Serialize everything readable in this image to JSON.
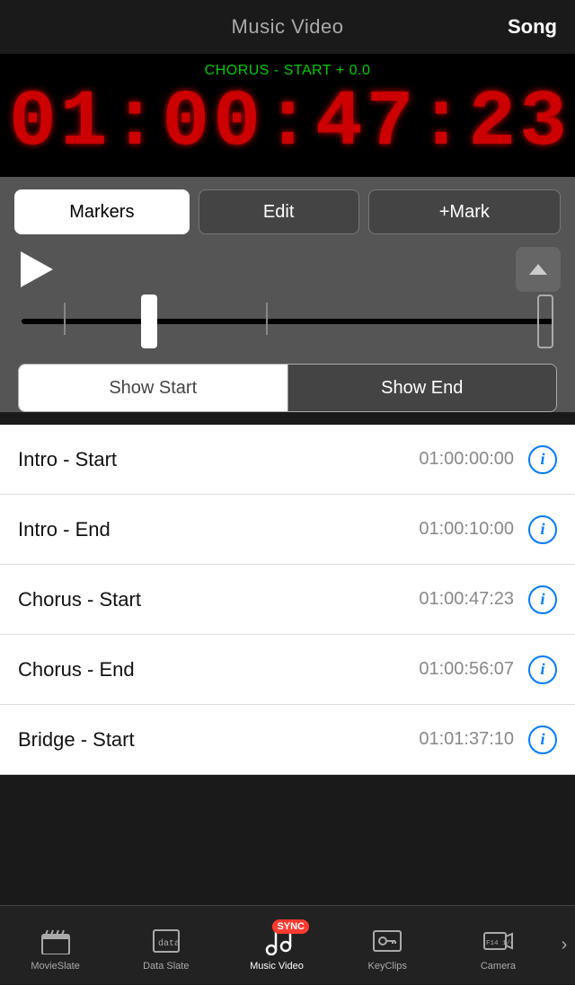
{
  "header": {
    "title": "Music Video",
    "song_label": "Song"
  },
  "timecode": {
    "label": "CHORUS - START + 0.0",
    "display": "01:00:47:23"
  },
  "toolbar": {
    "markers_label": "Markers",
    "edit_label": "Edit",
    "mark_label": "+Mark"
  },
  "toggle": {
    "show_start": "Show Start",
    "show_end": "Show End"
  },
  "markers": [
    {
      "name": "Intro - Start",
      "time": "01:00:00:00"
    },
    {
      "name": "Intro - End",
      "time": "01:00:10:00"
    },
    {
      "name": "Chorus - Start",
      "time": "01:00:47:23"
    },
    {
      "name": "Chorus - End",
      "time": "01:00:56:07"
    },
    {
      "name": "Bridge - Start",
      "time": "01:01:37:10"
    }
  ],
  "tabs": [
    {
      "id": "movieslate",
      "label": "MovieSlate"
    },
    {
      "id": "dataslate",
      "label": "Data Slate"
    },
    {
      "id": "musicvideo",
      "label": "Music Video",
      "active": true
    },
    {
      "id": "keyclips",
      "label": "KeyClips"
    },
    {
      "id": "camera",
      "label": "Camera"
    }
  ],
  "sync_badge": "SYNC",
  "colors": {
    "accent_blue": "#007aff",
    "timecode_red": "#cc0000",
    "timecode_dim": "#330000",
    "active_green": "#00cc00"
  }
}
